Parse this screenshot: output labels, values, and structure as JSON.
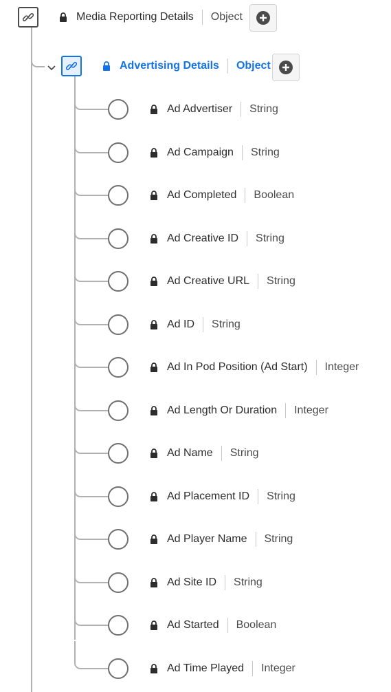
{
  "root": {
    "name": "Media Reporting Details",
    "type": "Object",
    "icon": "link-icon",
    "locked": true
  },
  "child": {
    "name": "Advertising Details",
    "type": "Object",
    "icon": "link-icon",
    "locked": true,
    "expanded": true,
    "selected": true,
    "accent": "#1473e6"
  },
  "fields": [
    {
      "name": "Ad Advertiser",
      "type": "String"
    },
    {
      "name": "Ad Campaign",
      "type": "String"
    },
    {
      "name": "Ad Completed",
      "type": "Boolean"
    },
    {
      "name": "Ad Creative ID",
      "type": "String"
    },
    {
      "name": "Ad Creative URL",
      "type": "String"
    },
    {
      "name": "Ad ID",
      "type": "String"
    },
    {
      "name": "Ad In Pod Position (Ad Start)",
      "type": "Integer"
    },
    {
      "name": "Ad Length Or Duration",
      "type": "Integer"
    },
    {
      "name": "Ad Name",
      "type": "String"
    },
    {
      "name": "Ad Placement ID",
      "type": "String"
    },
    {
      "name": "Ad Player Name",
      "type": "String"
    },
    {
      "name": "Ad Site ID",
      "type": "String"
    },
    {
      "name": "Ad Started",
      "type": "Boolean"
    },
    {
      "name": "Ad Time Played",
      "type": "Integer"
    }
  ]
}
